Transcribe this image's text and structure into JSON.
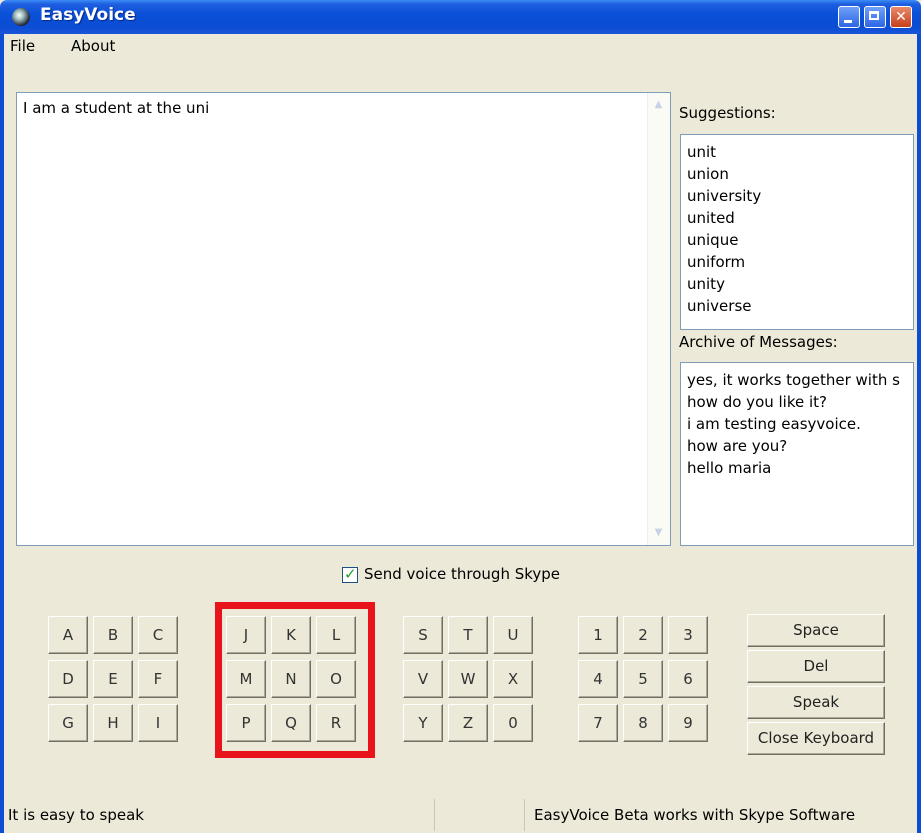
{
  "window": {
    "title": "EasyVoice"
  },
  "menu": {
    "items": [
      "File",
      "About"
    ]
  },
  "main_text": {
    "value": "I am a student at the uni"
  },
  "suggestions": {
    "label": "Suggestions:",
    "items": [
      "unit",
      "union",
      "university",
      "united",
      "unique",
      "uniform",
      "unity",
      "universe"
    ]
  },
  "archive": {
    "label": "Archive of Messages:",
    "items": [
      "yes, it works together with s",
      "how do you like it?",
      "i am testing easyvoice.",
      "how are you?",
      "hello maria"
    ]
  },
  "options": {
    "send_voice_label": "Send voice through Skype",
    "send_voice_checked": true
  },
  "keypad": {
    "group1": [
      "A",
      "B",
      "C",
      "D",
      "E",
      "F",
      "G",
      "H",
      "I"
    ],
    "group2": [
      "J",
      "K",
      "L",
      "M",
      "N",
      "O",
      "P",
      "Q",
      "R"
    ],
    "group3": [
      "S",
      "T",
      "U",
      "V",
      "W",
      "X",
      "Y",
      "Z",
      "0"
    ],
    "group4": [
      "1",
      "2",
      "3",
      "4",
      "5",
      "6",
      "7",
      "8",
      "9"
    ]
  },
  "actions": {
    "space": "Space",
    "del": "Del",
    "speak": "Speak",
    "close_keyboard": "Close Keyboard"
  },
  "status": {
    "left": "It is easy to speak",
    "right": "EasyVoice Beta works with Skype Software"
  },
  "icons": [
    "app-icon",
    "minimize-icon",
    "maximize-icon",
    "close-icon",
    "scroll-up-icon",
    "scroll-down-icon",
    "checkmark-icon"
  ],
  "colors": {
    "titlebar": "#0b4dd3",
    "highlight_border": "#e8131b",
    "window_bg": "#ece9d8"
  }
}
